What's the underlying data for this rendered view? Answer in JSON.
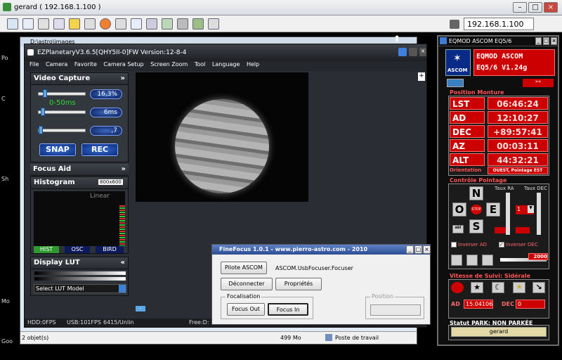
{
  "remote": {
    "title": "gerard ( 192.168.1.100 )",
    "ip": "192.168.1.100"
  },
  "desktop_labels": [
    "Po",
    "C",
    "Sh",
    "Mo",
    "Goo"
  ],
  "explorer": {
    "path": "D:\\astro\\images",
    "status_items": "2 objet(s)",
    "size": "499 Mo",
    "location": "Poste de travail"
  },
  "ez": {
    "title": "EZPlanetaryV3.6.5[QHY5II-0]FW Version:12-8-4",
    "menu": [
      "File",
      "Camera",
      "Favorite",
      "Camera Setup",
      "Screen Zoom",
      "Tool",
      "Language",
      "Help"
    ],
    "video_capture": "Video Capture",
    "gain": "16,3%",
    "exposure_range": "0-50ms",
    "exposure": "6ms",
    "gamma": ",7",
    "snap": "SNAP",
    "rec": "REC",
    "focus_aid": "Focus Aid",
    "histogram": "Histogram",
    "res": "800x600",
    "linear": "Linear",
    "hist_tabs": [
      "HIST",
      "OSC",
      "BIRD"
    ],
    "display_lut": "Display LUT",
    "lut_select": "Select LUT Model",
    "status": {
      "hdd": "HDD:0FPS",
      "usb": "USB:101FPS",
      "frames": "6415/Unlin",
      "free": "Free:D:"
    },
    "minus": "-",
    "plus": "+"
  },
  "finefocus": {
    "title": "FineFocus 1.0.1 - www.pierro-astro.com - 2010",
    "pilote": "Pilote ASCOM",
    "driver": "ASCOM.UsbFocuser.Focuser",
    "connect": "Déconnecter",
    "props": "Propriétés",
    "focalisation": "Focalisation",
    "focus_out": "Focus Out",
    "focus_in": "Focus In",
    "position": "Position"
  },
  "eqmod": {
    "title": "EQMOD ASCOM EQ5/6",
    "logo_text": "ASCOM",
    "name1": "EQMOD ASCOM",
    "name2": "EQ5/6 V1.24g",
    "position_label": "Position Monture",
    "coords": [
      {
        "k": "LST",
        "v": "06:46:24"
      },
      {
        "k": "AD",
        "v": "12:10:27"
      },
      {
        "k": "DEC",
        "v": "+89:57:41"
      },
      {
        "k": "AZ",
        "v": "00:03:11"
      },
      {
        "k": "ALT",
        "v": "44:32:21"
      }
    ],
    "orientation_label": "Orientation",
    "orientation": "OUEST, Pointage EST",
    "pointage_label": "Contrôle Pointage",
    "taux_ra": "Taux RA",
    "taux_dec": "Taux DEC",
    "dirs": {
      "n": "N",
      "s": "S",
      "e": "E",
      "o": "O",
      "stop": "STOP"
    },
    "rate": "1",
    "inv_ad": "Inverser AD",
    "inv_dec": "Inverser DEC",
    "speed": "2000",
    "vitesse_label": "Vitesse de Suivi: Sidérale",
    "ad_label": "AD",
    "ad_val": "15.04106",
    "dec_label": "DEC",
    "dec_val": "0",
    "park_label": "Statut PARK: NON PARKÉE",
    "park_btn": "gerard"
  },
  "colors": {
    "accent": "#cc0000",
    "panel": "#2a2d33",
    "eq_bg": "#0e0e0e"
  }
}
